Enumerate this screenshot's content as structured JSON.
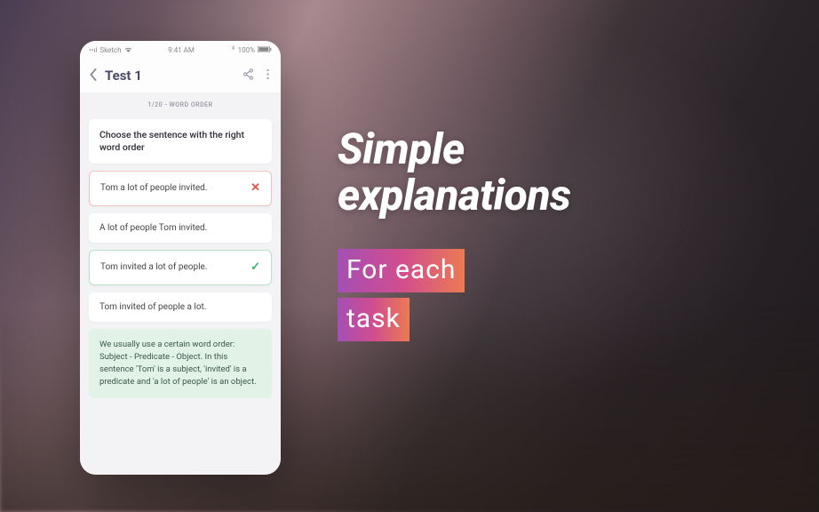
{
  "status_bar": {
    "carrier": "Sketch",
    "time": "9:41 AM",
    "battery": "100%"
  },
  "header": {
    "title": "Test 1"
  },
  "body": {
    "progress": "1/20 - WORD ORDER",
    "prompt": "Choose the sentence with the right word order",
    "answers": [
      {
        "text": "Tom a lot of people invited.",
        "state": "wrong"
      },
      {
        "text": "A lot of people Tom invited.",
        "state": ""
      },
      {
        "text": "Tom invited a lot of people.",
        "state": "correct"
      },
      {
        "text": "Tom invited of people a lot.",
        "state": ""
      }
    ],
    "explanation": "We usually use a certain word order: Subject - Predicate - Object. In this sentence 'Tom' is a subject, 'invited' is a predicate and 'a lot of people' is an object."
  },
  "promo": {
    "heading_l1": "Simple",
    "heading_l2": "explanations",
    "sub_l1": "For each",
    "sub_l2": "task"
  }
}
